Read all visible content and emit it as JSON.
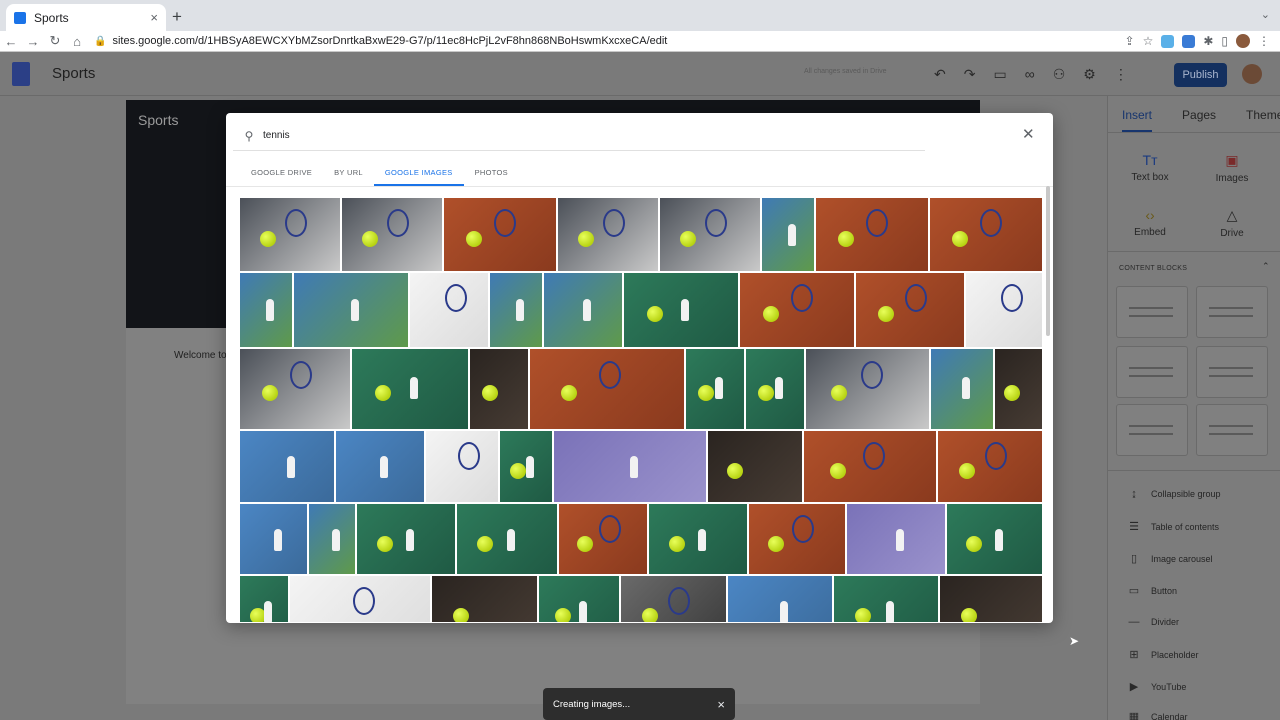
{
  "browser": {
    "tab_title": "Sports",
    "tab_close": "×",
    "new_tab": "+",
    "url": "sites.google.com/d/1HBSyA8EWCXYbMZsorDnrtkaBxwE29-G7/p/11ec8HcPjL2vF8hn868NBoHswmKxcxeCA/edit"
  },
  "sites_header": {
    "title": "Sports",
    "saved_status": "All changes saved in Drive",
    "publish_label": "Publish"
  },
  "page": {
    "banner_title": "Sports",
    "welcome_text": "Welcome to"
  },
  "sidebar": {
    "tabs": [
      "Insert",
      "Pages",
      "Themes"
    ],
    "tools": [
      {
        "label": "Text box",
        "icon": "text-box-icon"
      },
      {
        "label": "Images",
        "icon": "images-icon"
      },
      {
        "label": "Embed",
        "icon": "embed-icon"
      },
      {
        "label": "Drive",
        "icon": "drive-icon"
      }
    ],
    "content_blocks_label": "CONTENT BLOCKS",
    "items": [
      {
        "label": "Collapsible group",
        "icon": "collapsible-group-icon"
      },
      {
        "label": "Table of contents",
        "icon": "table-of-contents-icon"
      },
      {
        "label": "Image carousel",
        "icon": "image-carousel-icon"
      },
      {
        "label": "Button",
        "icon": "button-icon"
      },
      {
        "label": "Divider",
        "icon": "divider-icon"
      },
      {
        "label": "Placeholder",
        "icon": "placeholder-icon"
      },
      {
        "label": "YouTube",
        "icon": "youtube-icon"
      },
      {
        "label": "Calendar",
        "icon": "calendar-icon"
      }
    ]
  },
  "image_picker": {
    "search_value": "tennis",
    "tabs": [
      "GOOGLE DRIVE",
      "BY URL",
      "GOOGLE IMAGES",
      "PHOTOS"
    ],
    "active_tab": "GOOGLE IMAGES",
    "image_count": 58
  },
  "snackbar": {
    "text": "Creating images...",
    "close": "×"
  },
  "colors": {
    "accent": "#1a73e8",
    "publish": "#14305f",
    "snackbar": "#2d2d2d"
  }
}
